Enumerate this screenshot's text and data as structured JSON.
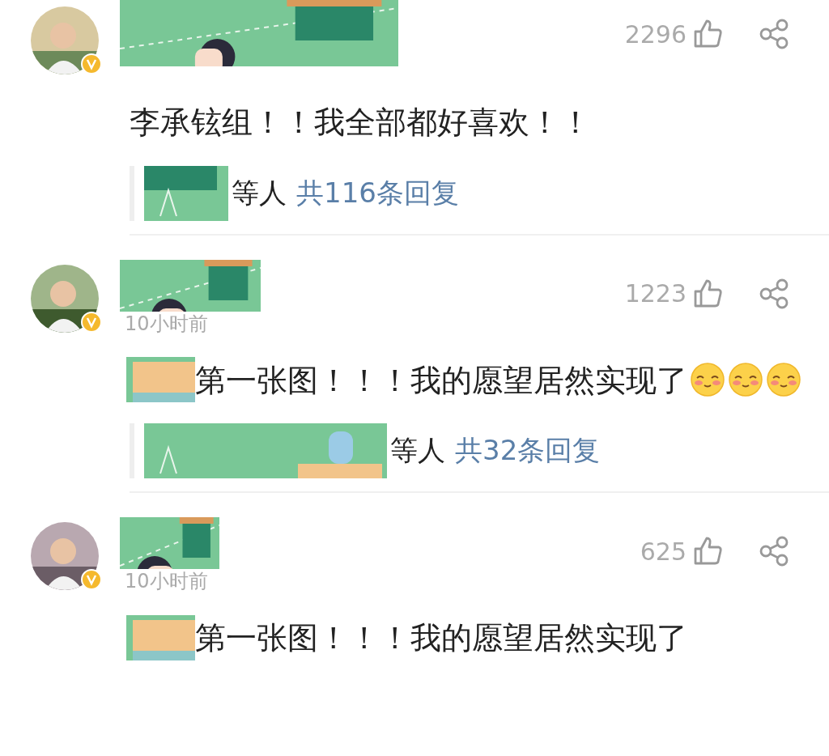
{
  "comments": [
    {
      "likes": "2296",
      "text": "李承铉组！！我全部都好喜欢！！",
      "replies": {
        "suffix": "等人",
        "link": "共116条回复"
      }
    },
    {
      "time": "10小时前",
      "likes": "1223",
      "text": "第一张图！！！我的愿望居然实现了",
      "emojis": [
        {
          "kind": "blush"
        },
        {
          "kind": "blush"
        },
        {
          "kind": "blush"
        }
      ],
      "replies": {
        "suffix": "等人",
        "link": "共32条回复"
      }
    },
    {
      "time": "10小时前",
      "likes": "625",
      "text": "第一张图！！！我的愿望居然实现了"
    }
  ]
}
